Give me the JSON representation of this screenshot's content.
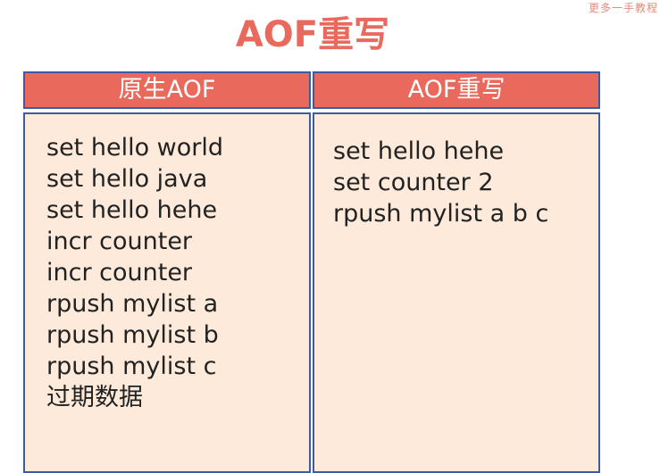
{
  "watermark": "更多一手教程",
  "title": "AOF重写",
  "columns": {
    "original": {
      "header": "原生AOF",
      "commands": [
        "set hello world",
        "set hello java",
        "set hello hehe",
        "incr counter",
        "incr counter",
        "rpush mylist a",
        "rpush mylist b",
        "rpush mylist c",
        "过期数据"
      ]
    },
    "rewritten": {
      "header": "AOF重写",
      "commands": [
        "set hello hehe",
        "set counter 2",
        "rpush mylist a b c"
      ]
    }
  },
  "colors": {
    "title": "#e96a5c",
    "header_fill": "#e96a5c",
    "border": "#3b5ca3",
    "body_fill": "#fdeadb"
  }
}
